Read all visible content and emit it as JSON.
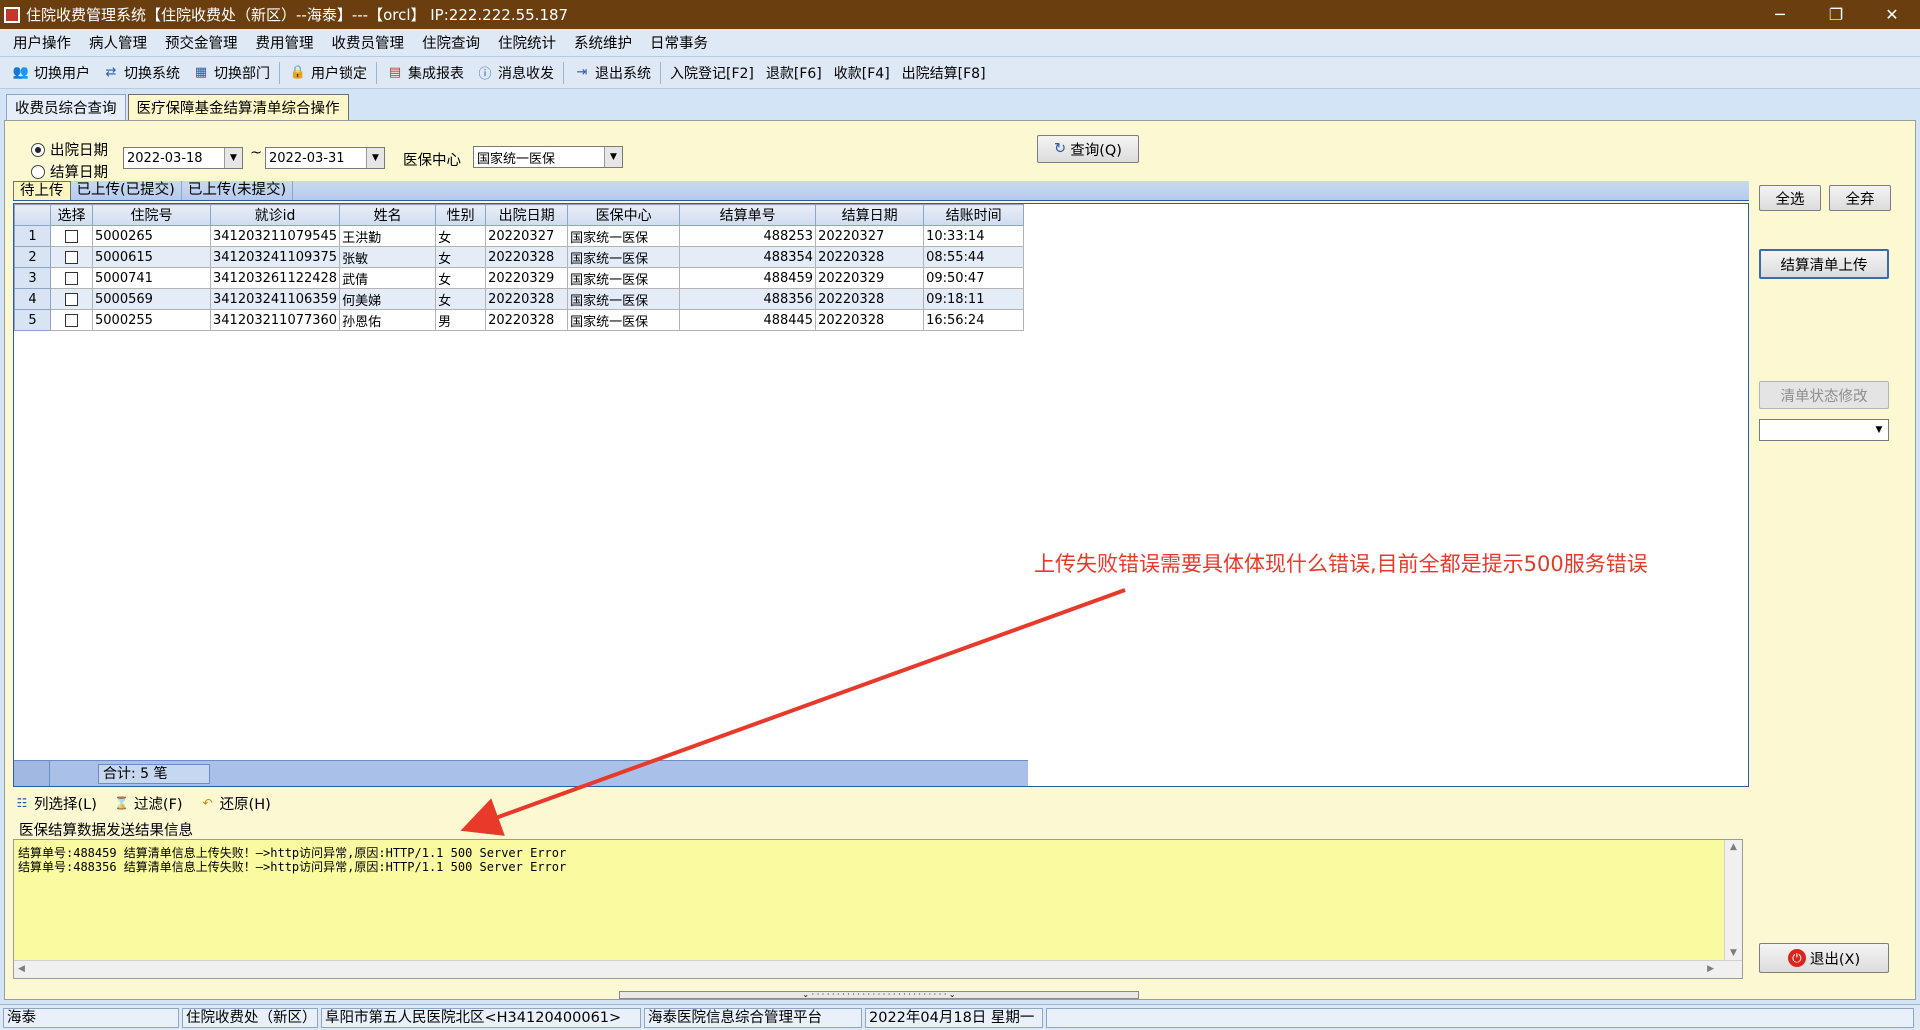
{
  "window": {
    "title": "住院收费管理系统【住院收费处（新区）--海泰】---【orcl】 IP:222.222.55.187",
    "min_glyph": "─",
    "restore_glyph": "❐",
    "close_glyph": "✕"
  },
  "menu": [
    "用户操作",
    "病人管理",
    "预交金管理",
    "费用管理",
    "收费员管理",
    "住院查询",
    "住院统计",
    "系统维护",
    "日常事务"
  ],
  "toolbar": {
    "switch_user": "切换用户",
    "switch_system": "切换系统",
    "switch_dept": "切换部门",
    "lock_user": "用户锁定",
    "reports": "集成报表",
    "messages": "消息收发",
    "exit_system": "退出系统",
    "admission": "入院登记[F2]",
    "refund": "退款[F6]",
    "charge": "收款[F4]",
    "discharge": "出院结算[F8]"
  },
  "tabs": [
    "收费员综合查询",
    "医疗保障基金结算清单综合操作"
  ],
  "filters": {
    "radio_discharge_date": "出院日期",
    "radio_settle_date": "结算日期",
    "date_from": "2022-03-18",
    "tilde": "~",
    "date_to": "2022-03-31",
    "center_label": "医保中心",
    "center_value": "国家统一医保",
    "query_button": "查询(Q)"
  },
  "subtabs": [
    "待上传",
    "已上传(已提交)",
    "已上传(未提交)"
  ],
  "grid": {
    "headers": [
      "选择",
      "住院号",
      "就诊id",
      "姓名",
      "性别",
      "出院日期",
      "医保中心",
      "结算单号",
      "结算日期",
      "结账时间"
    ],
    "rows": [
      {
        "n": "1",
        "no": "5000265",
        "visit": "341203211079545",
        "name": "王洪勤",
        "sex": "女",
        "out": "20220327",
        "center": "国家统一医保",
        "settle": "488253",
        "sdate": "20220327",
        "time": "10:33:14"
      },
      {
        "n": "2",
        "no": "5000615",
        "visit": "341203241109375",
        "name": "张敏",
        "sex": "女",
        "out": "20220328",
        "center": "国家统一医保",
        "settle": "488354",
        "sdate": "20220328",
        "time": "08:55:44"
      },
      {
        "n": "3",
        "no": "5000741",
        "visit": "341203261122428",
        "name": "武倩",
        "sex": "女",
        "out": "20220329",
        "center": "国家统一医保",
        "settle": "488459",
        "sdate": "20220329",
        "time": "09:50:47"
      },
      {
        "n": "4",
        "no": "5000569",
        "visit": "341203241106359",
        "name": "何美娣",
        "sex": "女",
        "out": "20220328",
        "center": "国家统一医保",
        "settle": "488356",
        "sdate": "20220328",
        "time": "09:18:11"
      },
      {
        "n": "5",
        "no": "5000255",
        "visit": "341203211077360",
        "name": "孙恩佑",
        "sex": "男",
        "out": "20220328",
        "center": "国家统一医保",
        "settle": "488445",
        "sdate": "20220328",
        "time": "16:56:24"
      }
    ],
    "total": "合计: 5 笔"
  },
  "annotation": "上传失败错误需要具体体现什么错误,目前全都是提示500服务错误",
  "grid_tools": {
    "columns": "列选择(L)",
    "filter": "过滤(F)",
    "restore": "还原(H)"
  },
  "result": {
    "title": "医保结算数据发送结果信息",
    "lines": [
      "结算单号:488459   结算清单信息上传失败！—>http访问异常,原因:HTTP/1.1 500 Server Error",
      "结算单号:488356   结算清单信息上传失败！—>http访问异常,原因:HTTP/1.1 500 Server Error"
    ]
  },
  "right": {
    "select_all": "全选",
    "deselect_all": "全弃",
    "upload": "结算清单上传",
    "modify_status": "清单状态修改",
    "status_select": "",
    "exit": "退出(X)"
  },
  "status": [
    "海泰",
    "住院收费处（新区）",
    "阜阳市第五人民医院北区<H34120400061>",
    "海泰医院信息综合管理平台",
    "2022年04月18日 星期一"
  ],
  "colors": {
    "titlebar": "#6b3e0f",
    "annotation": "#e8392b",
    "log_bg": "#fafaa0",
    "panel_bg": "#fbf8d2"
  }
}
